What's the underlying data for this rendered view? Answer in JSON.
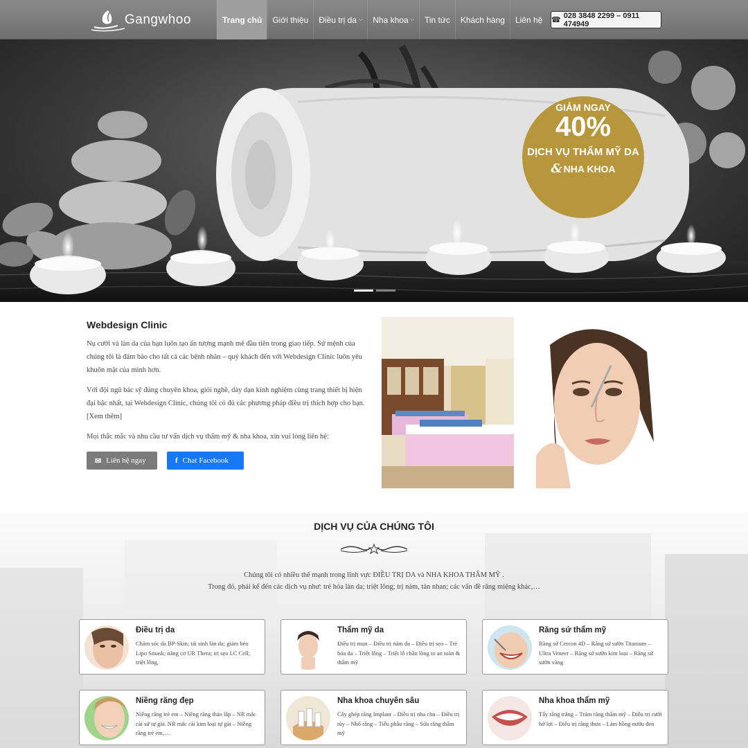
{
  "header": {
    "logo_text": "Gangwhoo",
    "nav": [
      {
        "label": "Trang chủ",
        "active": true,
        "dropdown": false
      },
      {
        "label": "Giới thiệu",
        "active": false,
        "dropdown": false
      },
      {
        "label": "Điều trị da",
        "active": false,
        "dropdown": true
      },
      {
        "label": "Nha khoa",
        "active": false,
        "dropdown": true
      },
      {
        "label": "Tin tức",
        "active": false,
        "dropdown": false
      },
      {
        "label": "Khách hàng",
        "active": false,
        "dropdown": false
      },
      {
        "label": "Liên hệ",
        "active": false,
        "dropdown": false
      }
    ],
    "phone": "028 3848 2299 – 0911 474949"
  },
  "hero": {
    "promo_line1": "GIẢM NGAY",
    "promo_line2": "40%",
    "promo_line3": "DỊCH VỤ THẨM MỸ DA",
    "promo_amp": "&",
    "promo_line4": "NHA KHOA",
    "slides": 2,
    "active_slide": 1
  },
  "about": {
    "title": "Webdesign Clinic",
    "para1": "Nụ cười và làn da của bạn luôn tạo ấn tượng mạnh mẽ đầu tiên trong giao tiếp. Sứ mệnh của chúng tôi là đảm bảo cho tất cả các bệnh nhân – quý khách đến với Webdesign Clinic luôn yêu khuôn mặt của mình hơn.",
    "para2": "Với đội ngũ bác sỹ đúng chuyên khoa, giỏi nghề, dày dạn kinh nghiệm cùng trang thiết bị hiện đại bậc nhất, tại Webdesign Clinic, chúng tôi có đủ các phương pháp điều trị thích hợp cho bạn. ",
    "more_link": "[Xem thêm]",
    "para3": "Mọi thắc mắc và nhu cầu tư vấn dịch vụ thẩm mỹ & nha khoa, xin vui lòng liên hệ:",
    "btn_contact": "Liên hệ ngay",
    "btn_facebook": "Chat Facebook"
  },
  "services": {
    "title": "DỊCH VỤ CỦA CHÚNG TÔI",
    "intro1": "Chúng tôi có nhiều thế mạnh trong lĩnh vực  ĐIỀU TRỊ DA  và  NHA KHOA THẨM MỸ .",
    "intro2": "Trong đó, phải kể đến các dịch vụ như: trẻ hóa làn da; triệt lông; trị nám, tàn nhan; các vấn đề răng miệng khác,…",
    "cards": [
      {
        "title": "Điều trị da",
        "desc": "Chăm sóc da BP-Skin; tái sinh làn da; giảm béo Lipo Smask; nâng cơ UR Thera; trị sẹo LC Cell; triệt lông,"
      },
      {
        "title": "Thẩm mỹ da",
        "desc": "Điều trị mụn – Điều trị nám da – Điều trị sẹo – Trẻ hóa da – Triệt lông – Triệt lỗ chân lông to an toàn & thẩm mỹ"
      },
      {
        "title": "Răng sứ thẩm mỹ",
        "desc": "Răng sứ Cercon 4D – Răng sứ sườn Titanium – Ultra Veneer – Răng sứ sườn kim loại – Răng sứ sườn vàng"
      },
      {
        "title": "Niềng răng đẹp",
        "desc": "Niềng răng trẻ em – Niềng răng tháo lắp – NR mắc cài sứ tự gài. NR mắc cài kim loại tự gài – Niềng răng trẻ em,…"
      },
      {
        "title": "Nha khoa chuyên sâu",
        "desc": "Cấy ghép răng Implant – Điều trị nha chu – Điều trị tủy – Nhổ răng – Tiểu phẫu răng – Sửa răng thẩm mỹ"
      },
      {
        "title": "Nha khoa thẩm mỹ",
        "desc": "Tẩy răng trắng – Trám răng thẩm mỹ – Điều trị cười hở lợi – Điều trị răng thưa – Làm hồng nướu đen"
      }
    ]
  },
  "colors": {
    "facebook": "#1877f2",
    "promo": "#b8973c",
    "contact_button": "#7b7b7b"
  }
}
